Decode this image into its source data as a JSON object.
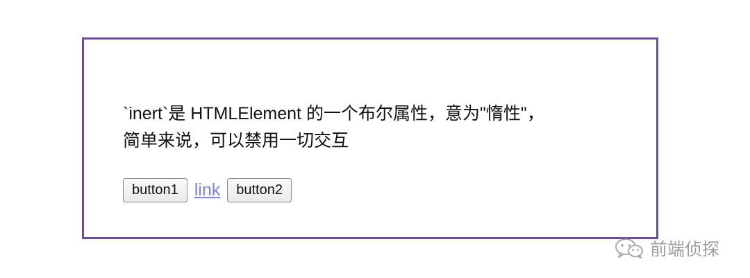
{
  "demo": {
    "description_line1": "`inert`是 HTMLElement 的一个布尔属性，意为\"惰性\"，",
    "description_line2": "简单来说，可以禁用一切交互",
    "button1_label": "button1",
    "link_label": "link",
    "button2_label": "button2"
  },
  "watermark": {
    "text": "前端侦探",
    "icon": "wechat-icon"
  },
  "colors": {
    "border": "#6a4e9a",
    "link": "#7b82e0",
    "watermark": "#8c8c8c"
  }
}
